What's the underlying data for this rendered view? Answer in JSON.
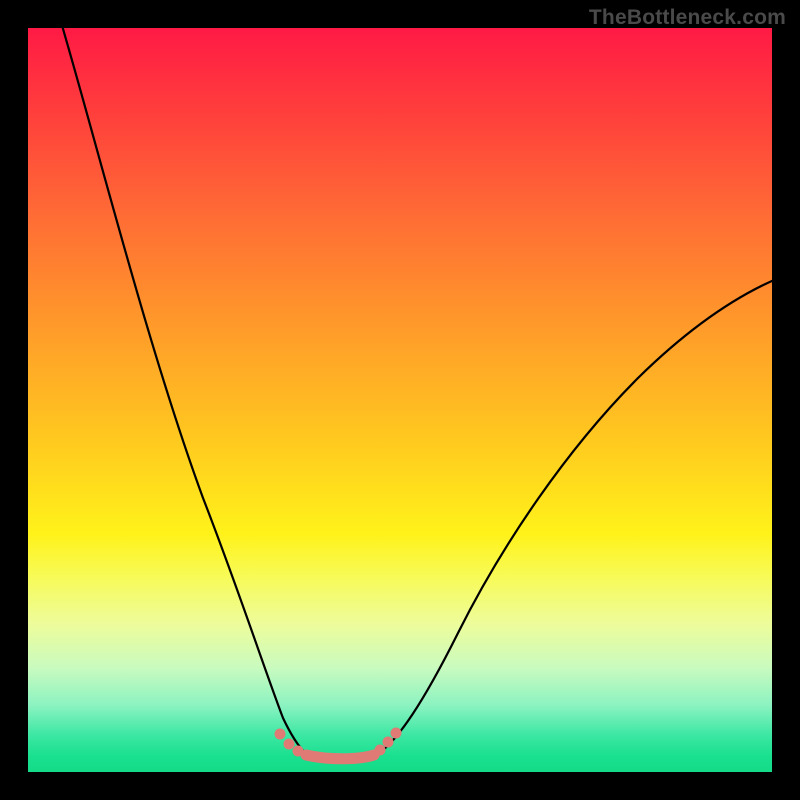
{
  "watermark": "TheBottleneck.com",
  "chart_data": {
    "type": "line",
    "title": "",
    "xlabel": "",
    "ylabel": "",
    "xlim": [
      0,
      1
    ],
    "ylim": [
      0,
      1
    ],
    "grid": false,
    "legend": null,
    "series": [
      {
        "name": "left-curve",
        "x": [
          0.045,
          0.08,
          0.12,
          0.16,
          0.2,
          0.24,
          0.27,
          0.3,
          0.315,
          0.33,
          0.345,
          0.36
        ],
        "y": [
          1.0,
          0.86,
          0.7,
          0.55,
          0.4,
          0.27,
          0.18,
          0.1,
          0.07,
          0.05,
          0.035,
          0.022
        ]
      },
      {
        "name": "right-curve",
        "x": [
          0.47,
          0.5,
          0.54,
          0.58,
          0.63,
          0.7,
          0.78,
          0.86,
          0.93,
          1.0
        ],
        "y": [
          0.022,
          0.05,
          0.1,
          0.16,
          0.24,
          0.34,
          0.44,
          0.53,
          0.6,
          0.66
        ]
      },
      {
        "name": "flat-bottom",
        "x": [
          0.36,
          0.47
        ],
        "y": [
          0.022,
          0.022
        ]
      }
    ],
    "markers": {
      "name": "salmon-dots",
      "x": [
        0.335,
        0.35,
        0.36,
        0.375,
        0.395,
        0.415,
        0.435,
        0.45,
        0.462,
        0.475
      ],
      "y": [
        0.045,
        0.033,
        0.026,
        0.022,
        0.02,
        0.02,
        0.022,
        0.027,
        0.034,
        0.043
      ]
    },
    "annotations": [],
    "gradient_stops": [
      {
        "pos": 0.0,
        "color": "#ff1a45"
      },
      {
        "pos": 0.25,
        "color": "#ff6b35"
      },
      {
        "pos": 0.55,
        "color": "#ffc81f"
      },
      {
        "pos": 0.74,
        "color": "#f7fb5a"
      },
      {
        "pos": 0.91,
        "color": "#8cf3c1"
      },
      {
        "pos": 1.0,
        "color": "#14db87"
      }
    ]
  }
}
